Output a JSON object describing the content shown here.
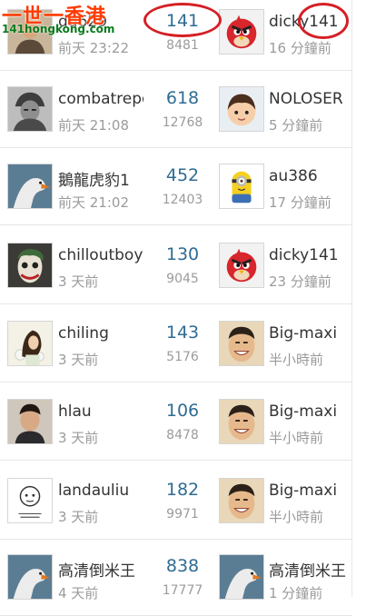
{
  "watermark": {
    "line1": "一世一香港",
    "line2": "141hongkong.com"
  },
  "rows": [
    {
      "starter_avatar": "person-avatar",
      "starter": "dd629",
      "starter_time": "前天 23:22",
      "replies": "141",
      "views": "8481",
      "last_avatar": "angry-bird-avatar",
      "last_poster": "dicky141",
      "last_time": "16 分鐘前"
    },
    {
      "starter_avatar": "soldier-avatar",
      "starter": "combatrepc",
      "starter_time": "前天 21:08",
      "replies": "618",
      "views": "12768",
      "last_avatar": "cartoon-boy-avatar",
      "last_poster": "NOLOSER",
      "last_time": "5 分鐘前"
    },
    {
      "starter_avatar": "swan-avatar",
      "starter": "鵝龍虎豹1",
      "starter_time": "前天 21:02",
      "replies": "452",
      "views": "12403",
      "last_avatar": "minion-avatar",
      "last_poster": "au386",
      "last_time": "17 分鐘前"
    },
    {
      "starter_avatar": "joker-avatar",
      "starter": "chilloutboy",
      "starter_time": "3 天前",
      "replies": "130",
      "views": "9045",
      "last_avatar": "angry-bird-avatar",
      "last_poster": "dicky141",
      "last_time": "23 分鐘前"
    },
    {
      "starter_avatar": "woman-flowers-avatar",
      "starter": "chiling",
      "starter_time": "3 天前",
      "replies": "143",
      "views": "5176",
      "last_avatar": "smiling-man-avatar",
      "last_poster": "Big-maxi",
      "last_time": "半小時前"
    },
    {
      "starter_avatar": "man-portrait-avatar",
      "starter": "hlau",
      "starter_time": "3 天前",
      "replies": "106",
      "views": "8478",
      "last_avatar": "smiling-man-avatar",
      "last_poster": "Big-maxi",
      "last_time": "半小時前"
    },
    {
      "starter_avatar": "doodle-avatar",
      "starter": "landauliu",
      "starter_time": "3 天前",
      "replies": "182",
      "views": "9971",
      "last_avatar": "smiling-man-avatar",
      "last_poster": "Big-maxi",
      "last_time": "半小時前"
    },
    {
      "starter_avatar": "swan-avatar",
      "starter": "高清倒米王",
      "starter_time": "4 天前",
      "replies": "838",
      "views": "17777",
      "last_avatar": "swan-avatar",
      "last_poster": "高清倒米王",
      "last_time": "1 分鐘前"
    }
  ],
  "annotation_color": "#d51f25",
  "reply_color": "#2f6c93"
}
